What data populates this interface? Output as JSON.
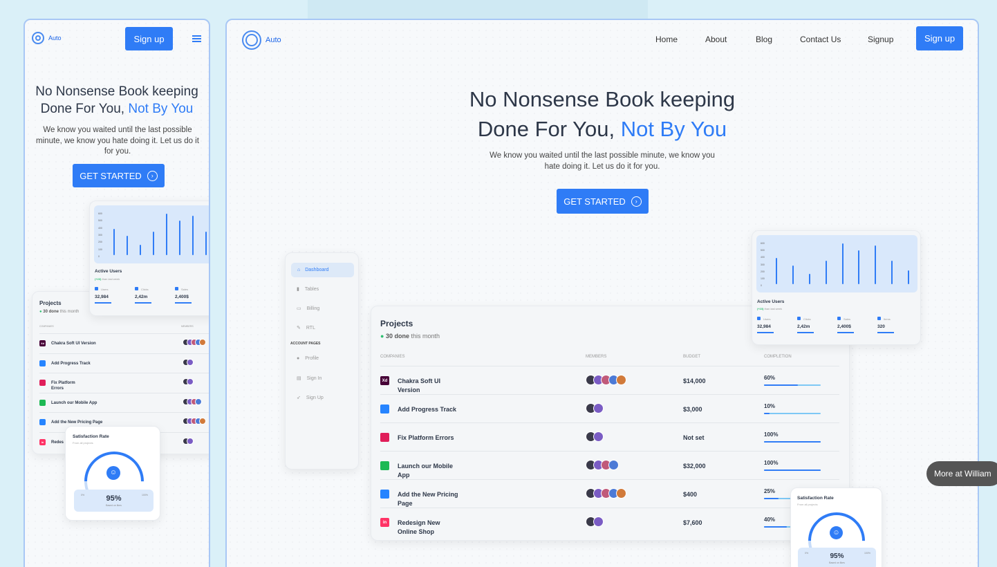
{
  "brand": {
    "name": "Auto",
    "accent": "#2f7cf6"
  },
  "nav": {
    "links": [
      "Home",
      "About",
      "Blog",
      "Contact Us",
      "Signup"
    ],
    "signup_button": "Sign up"
  },
  "hero": {
    "title_line1": "No Nonsense Book keeping",
    "title_line2_plain": "Done For You, ",
    "title_line2_accent": "Not By You",
    "subtitle": "We know you waited until the last possible minute, we know you hate doing it. Let us do it for you.",
    "cta": "GET STARTED"
  },
  "sidebar": {
    "items": [
      "Dashboard",
      "Tables",
      "Billing",
      "RTL"
    ],
    "section": "ACCOUNT PAGES",
    "account_items": [
      "Profile",
      "Sign In",
      "Sign Up"
    ]
  },
  "active_users": {
    "title": "Active Users",
    "change": "(+23)",
    "change_suffix": " than last week",
    "y_ticks": [
      "600",
      "500",
      "400",
      "300",
      "200",
      "100",
      "0"
    ],
    "bar_values": [
      370,
      270,
      150,
      330,
      580,
      480,
      550,
      330,
      200
    ],
    "stats": [
      {
        "label": "Users",
        "value": "32,984",
        "icon": "wallet-icon"
      },
      {
        "label": "Clicks",
        "value": "2,42m",
        "icon": "rocket-icon"
      },
      {
        "label": "Sales",
        "value": "2,400$",
        "icon": "cart-icon"
      },
      {
        "label": "Items",
        "value": "320",
        "icon": "wrench-icon"
      }
    ]
  },
  "projects": {
    "title": "Projects",
    "done": "30 done",
    "done_suffix": " this month",
    "headers": [
      "COMPANIES",
      "MEMBERS",
      "BUDGET",
      "COMPLETION"
    ],
    "rows": [
      {
        "name": "Chakra Soft UI Version",
        "budget": "$14,000",
        "completion": "60%",
        "progress": 0.6,
        "members": 5,
        "icon": "xd-icon",
        "icon_text": "Xd",
        "icon_color": "#470137"
      },
      {
        "name": "Add Progress Track",
        "budget": "$3,000",
        "completion": "10%",
        "progress": 0.1,
        "members": 2,
        "icon": "atlassian-icon",
        "icon_text": "",
        "icon_color": "#2684ff"
      },
      {
        "name": "Fix Platform Errors",
        "budget": "Not set",
        "completion": "100%",
        "progress": 1.0,
        "members": 2,
        "icon": "slack-icon",
        "icon_text": "",
        "icon_color": "#e01e5a"
      },
      {
        "name": "Launch our Mobile App",
        "budget": "$32,000",
        "completion": "100%",
        "progress": 1.0,
        "members": 4,
        "icon": "spotify-icon",
        "icon_text": "",
        "icon_color": "#1db954"
      },
      {
        "name": "Add the New Pricing Page",
        "budget": "$400",
        "completion": "25%",
        "progress": 0.25,
        "members": 5,
        "icon": "jira-icon",
        "icon_text": "",
        "icon_color": "#2684ff"
      },
      {
        "name": "Redesign New Online Shop",
        "budget": "$7,600",
        "completion": "40%",
        "progress": 0.4,
        "members": 2,
        "icon": "invision-icon",
        "icon_text": "in",
        "icon_color": "#ff3366"
      }
    ]
  },
  "satisfaction": {
    "title": "Satisfaction Rate",
    "subtitle": "From all projects",
    "value": "95%",
    "value_fraction": 0.95,
    "caption": "Based on likes",
    "min": "0%",
    "max": "100%"
  },
  "mobile": {
    "signup_button": "Sign up",
    "project_rows_partial": [
      "Chakra Soft UI Version",
      "Add Progress Track",
      "Fix Platform",
      "Launch our Mobile App",
      "Add the New Pricing Page",
      "Redes"
    ],
    "fix_second_line": "Errors"
  },
  "tooltip": {
    "more": "More at William"
  }
}
